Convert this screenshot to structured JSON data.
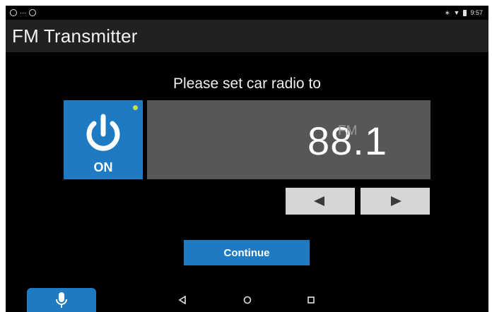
{
  "status_bar": {
    "left_icons": [
      "circle-icon",
      "notification-icon",
      "steering-wheel-icon"
    ],
    "right_icons": [
      "bluetooth-icon",
      "wifi-icon",
      "battery-icon"
    ],
    "time": "9:57"
  },
  "app_bar": {
    "title": "FM Transmitter"
  },
  "main": {
    "prompt": "Please set car radio to",
    "power_label": "ON",
    "frequency": "88.1",
    "unit": "FM",
    "continue_label": "Continue"
  },
  "colors": {
    "accent": "#1e7bc3",
    "panel": "#575757",
    "appbar": "#212121",
    "status_dot": "#c6e04a"
  }
}
